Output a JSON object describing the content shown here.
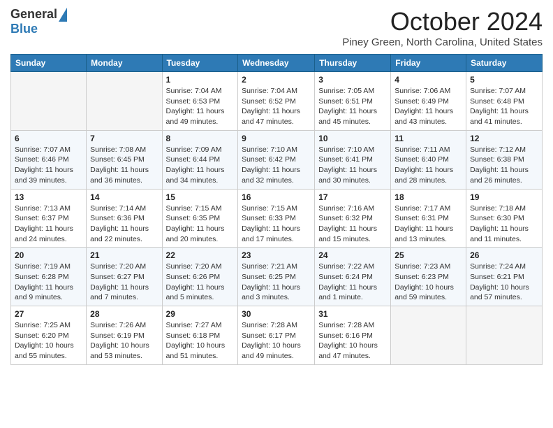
{
  "header": {
    "logo_general": "General",
    "logo_blue": "Blue",
    "month_title": "October 2024",
    "location": "Piney Green, North Carolina, United States"
  },
  "weekdays": [
    "Sunday",
    "Monday",
    "Tuesday",
    "Wednesday",
    "Thursday",
    "Friday",
    "Saturday"
  ],
  "weeks": [
    [
      {
        "day": "",
        "info": ""
      },
      {
        "day": "",
        "info": ""
      },
      {
        "day": "1",
        "sunrise": "Sunrise: 7:04 AM",
        "sunset": "Sunset: 6:53 PM",
        "daylight": "Daylight: 11 hours and 49 minutes."
      },
      {
        "day": "2",
        "sunrise": "Sunrise: 7:04 AM",
        "sunset": "Sunset: 6:52 PM",
        "daylight": "Daylight: 11 hours and 47 minutes."
      },
      {
        "day": "3",
        "sunrise": "Sunrise: 7:05 AM",
        "sunset": "Sunset: 6:51 PM",
        "daylight": "Daylight: 11 hours and 45 minutes."
      },
      {
        "day": "4",
        "sunrise": "Sunrise: 7:06 AM",
        "sunset": "Sunset: 6:49 PM",
        "daylight": "Daylight: 11 hours and 43 minutes."
      },
      {
        "day": "5",
        "sunrise": "Sunrise: 7:07 AM",
        "sunset": "Sunset: 6:48 PM",
        "daylight": "Daylight: 11 hours and 41 minutes."
      }
    ],
    [
      {
        "day": "6",
        "sunrise": "Sunrise: 7:07 AM",
        "sunset": "Sunset: 6:46 PM",
        "daylight": "Daylight: 11 hours and 39 minutes."
      },
      {
        "day": "7",
        "sunrise": "Sunrise: 7:08 AM",
        "sunset": "Sunset: 6:45 PM",
        "daylight": "Daylight: 11 hours and 36 minutes."
      },
      {
        "day": "8",
        "sunrise": "Sunrise: 7:09 AM",
        "sunset": "Sunset: 6:44 PM",
        "daylight": "Daylight: 11 hours and 34 minutes."
      },
      {
        "day": "9",
        "sunrise": "Sunrise: 7:10 AM",
        "sunset": "Sunset: 6:42 PM",
        "daylight": "Daylight: 11 hours and 32 minutes."
      },
      {
        "day": "10",
        "sunrise": "Sunrise: 7:10 AM",
        "sunset": "Sunset: 6:41 PM",
        "daylight": "Daylight: 11 hours and 30 minutes."
      },
      {
        "day": "11",
        "sunrise": "Sunrise: 7:11 AM",
        "sunset": "Sunset: 6:40 PM",
        "daylight": "Daylight: 11 hours and 28 minutes."
      },
      {
        "day": "12",
        "sunrise": "Sunrise: 7:12 AM",
        "sunset": "Sunset: 6:38 PM",
        "daylight": "Daylight: 11 hours and 26 minutes."
      }
    ],
    [
      {
        "day": "13",
        "sunrise": "Sunrise: 7:13 AM",
        "sunset": "Sunset: 6:37 PM",
        "daylight": "Daylight: 11 hours and 24 minutes."
      },
      {
        "day": "14",
        "sunrise": "Sunrise: 7:14 AM",
        "sunset": "Sunset: 6:36 PM",
        "daylight": "Daylight: 11 hours and 22 minutes."
      },
      {
        "day": "15",
        "sunrise": "Sunrise: 7:15 AM",
        "sunset": "Sunset: 6:35 PM",
        "daylight": "Daylight: 11 hours and 20 minutes."
      },
      {
        "day": "16",
        "sunrise": "Sunrise: 7:15 AM",
        "sunset": "Sunset: 6:33 PM",
        "daylight": "Daylight: 11 hours and 17 minutes."
      },
      {
        "day": "17",
        "sunrise": "Sunrise: 7:16 AM",
        "sunset": "Sunset: 6:32 PM",
        "daylight": "Daylight: 11 hours and 15 minutes."
      },
      {
        "day": "18",
        "sunrise": "Sunrise: 7:17 AM",
        "sunset": "Sunset: 6:31 PM",
        "daylight": "Daylight: 11 hours and 13 minutes."
      },
      {
        "day": "19",
        "sunrise": "Sunrise: 7:18 AM",
        "sunset": "Sunset: 6:30 PM",
        "daylight": "Daylight: 11 hours and 11 minutes."
      }
    ],
    [
      {
        "day": "20",
        "sunrise": "Sunrise: 7:19 AM",
        "sunset": "Sunset: 6:28 PM",
        "daylight": "Daylight: 11 hours and 9 minutes."
      },
      {
        "day": "21",
        "sunrise": "Sunrise: 7:20 AM",
        "sunset": "Sunset: 6:27 PM",
        "daylight": "Daylight: 11 hours and 7 minutes."
      },
      {
        "day": "22",
        "sunrise": "Sunrise: 7:20 AM",
        "sunset": "Sunset: 6:26 PM",
        "daylight": "Daylight: 11 hours and 5 minutes."
      },
      {
        "day": "23",
        "sunrise": "Sunrise: 7:21 AM",
        "sunset": "Sunset: 6:25 PM",
        "daylight": "Daylight: 11 hours and 3 minutes."
      },
      {
        "day": "24",
        "sunrise": "Sunrise: 7:22 AM",
        "sunset": "Sunset: 6:24 PM",
        "daylight": "Daylight: 11 hours and 1 minute."
      },
      {
        "day": "25",
        "sunrise": "Sunrise: 7:23 AM",
        "sunset": "Sunset: 6:23 PM",
        "daylight": "Daylight: 10 hours and 59 minutes."
      },
      {
        "day": "26",
        "sunrise": "Sunrise: 7:24 AM",
        "sunset": "Sunset: 6:21 PM",
        "daylight": "Daylight: 10 hours and 57 minutes."
      }
    ],
    [
      {
        "day": "27",
        "sunrise": "Sunrise: 7:25 AM",
        "sunset": "Sunset: 6:20 PM",
        "daylight": "Daylight: 10 hours and 55 minutes."
      },
      {
        "day": "28",
        "sunrise": "Sunrise: 7:26 AM",
        "sunset": "Sunset: 6:19 PM",
        "daylight": "Daylight: 10 hours and 53 minutes."
      },
      {
        "day": "29",
        "sunrise": "Sunrise: 7:27 AM",
        "sunset": "Sunset: 6:18 PM",
        "daylight": "Daylight: 10 hours and 51 minutes."
      },
      {
        "day": "30",
        "sunrise": "Sunrise: 7:28 AM",
        "sunset": "Sunset: 6:17 PM",
        "daylight": "Daylight: 10 hours and 49 minutes."
      },
      {
        "day": "31",
        "sunrise": "Sunrise: 7:28 AM",
        "sunset": "Sunset: 6:16 PM",
        "daylight": "Daylight: 10 hours and 47 minutes."
      },
      {
        "day": "",
        "info": ""
      },
      {
        "day": "",
        "info": ""
      }
    ]
  ]
}
